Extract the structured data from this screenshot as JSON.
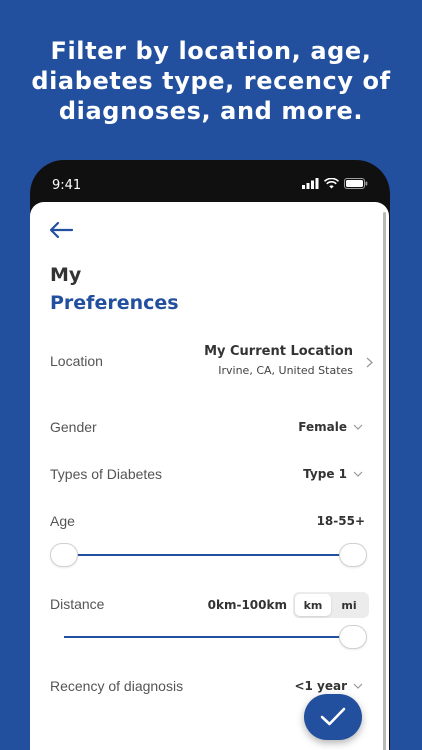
{
  "headline": {
    "line1": "Filter by location, age,",
    "line2": "diabetes type, recency of",
    "line3": "diagnoses, and more."
  },
  "status_bar": {
    "time": "9:41"
  },
  "header": {
    "title_line1": "My",
    "title_line2": "Preferences"
  },
  "location": {
    "label": "Location",
    "value": "My Current Location",
    "subvalue": "Irvine, CA, United States"
  },
  "gender": {
    "label": "Gender",
    "value": "Female"
  },
  "diabetes_type": {
    "label": "Types of Diabetes",
    "value": "Type 1"
  },
  "age": {
    "label": "Age",
    "value": "18-55+"
  },
  "distance": {
    "label": "Distance",
    "value": "0km-100km",
    "units": [
      "km",
      "mi"
    ],
    "selected_unit": "km"
  },
  "recency": {
    "label": "Recency of diagnosis",
    "value": "<1 year"
  },
  "colors": {
    "brand": "#23509e",
    "background": "#23509e"
  },
  "icons": [
    "back-arrow-icon",
    "chevron-right-icon",
    "chevron-down-icon",
    "checkmark-icon",
    "signal-icon",
    "wifi-icon",
    "battery-icon"
  ]
}
